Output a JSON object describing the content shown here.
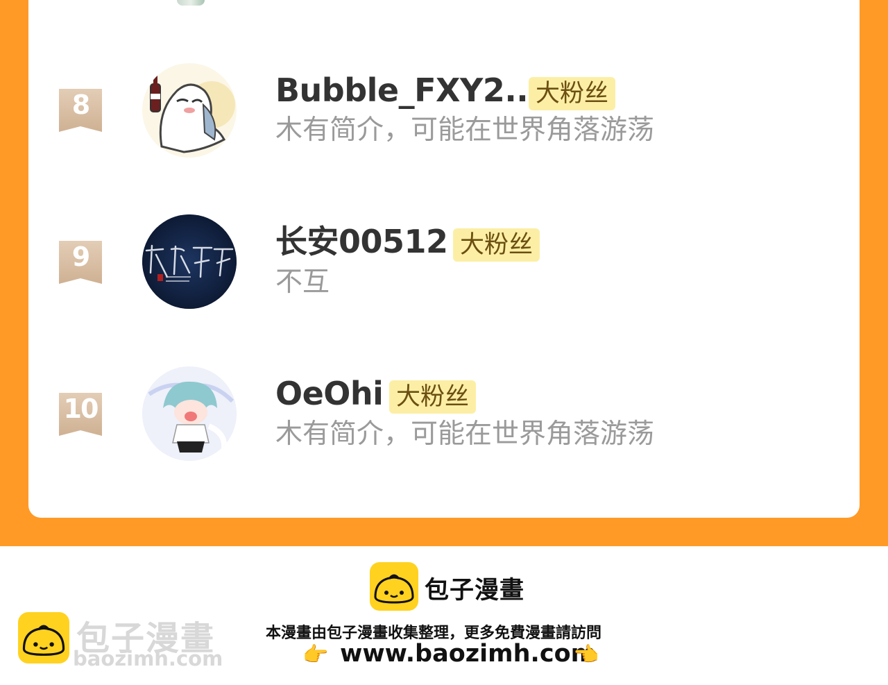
{
  "ranking": [
    {
      "rank": "8",
      "name": "Bubble_FXY2...",
      "badge": "大粉丝",
      "bio": "木有简介，可能在世界角落游荡"
    },
    {
      "rank": "9",
      "name": "长安00512",
      "badge": "大粉丝",
      "bio": "不互"
    },
    {
      "rank": "10",
      "name": "OeOhi",
      "badge": "大粉丝",
      "bio": "木有简介，可能在世界角落游荡"
    }
  ],
  "footer": {
    "brand": "包子漫畫",
    "note": "本漫畫由包子漫畫收集整理，更多免費漫畫請訪問",
    "url": "www.baozimh.com",
    "hand_left": "👉",
    "hand_right": "👈"
  },
  "watermark": {
    "brand": "包子漫畫",
    "url": "baozimh.com"
  },
  "colors": {
    "background": "#FF9A27",
    "card": "#FFFFFF",
    "badge_bg": "#FCEFA5",
    "rank_ribbon": "#D9BFA5",
    "logo_yellow": "#FFD21F"
  }
}
